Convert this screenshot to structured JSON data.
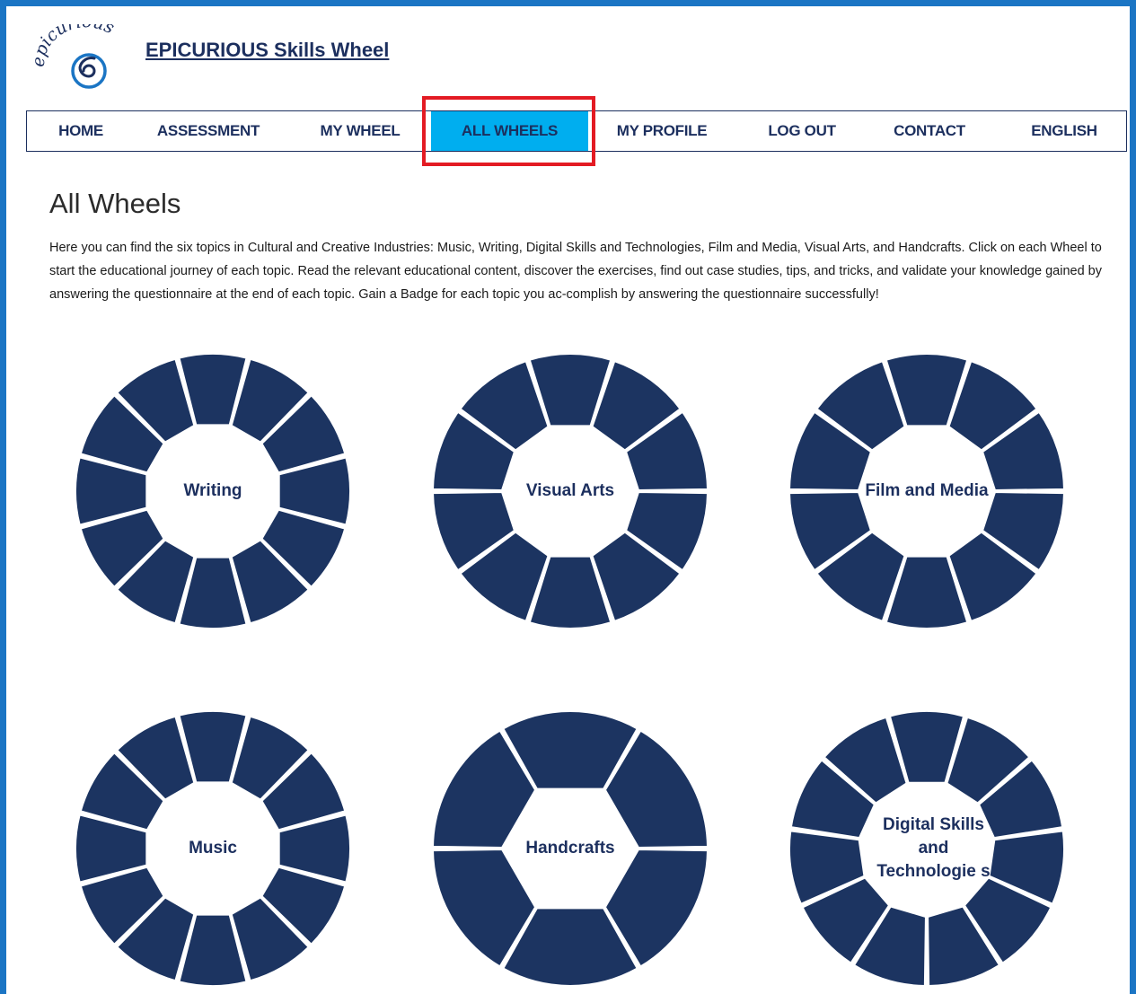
{
  "header": {
    "logo_text": "epicurious",
    "site_title": "EPICURIOUS Skills Wheel"
  },
  "nav": {
    "items": [
      "HOME",
      "ASSESSMENT",
      "MY WHEEL",
      "ALL WHEELS",
      "MY PROFILE",
      "LOG OUT",
      "CONTACT",
      "ENGLISH"
    ],
    "active": "ALL WHEELS"
  },
  "main": {
    "heading": "All Wheels",
    "intro": "Here you can find the six topics in Cultural and Creative Industries: Music, Writing, Digital Skills and Technologies, Film and Media, Visual Arts, and Handcrafts. Click on each Wheel to start the educational journey of each topic. Read the relevant educational content, discover the exercises, find out case studies, tips, and tricks, and validate your knowledge gained by answering the questionnaire at the end of each topic. Gain a Badge for each topic you ac-complish by answering the questionnaire successfully!",
    "wheels": [
      {
        "label": "Writing",
        "segments": 12
      },
      {
        "label": "Visual Arts",
        "segments": 10
      },
      {
        "label": "Film and Media",
        "segments": 10
      },
      {
        "label": "Music",
        "segments": 12
      },
      {
        "label": "Handcrafts",
        "segments": 6
      },
      {
        "label": "Digital Skills and Technologie s",
        "segments": 11
      }
    ]
  },
  "colors": {
    "frame": "#1b75c4",
    "wheel": "#1c3461",
    "nav_active": "#00aeef",
    "highlight": "#e31b23",
    "brand_text": "#1c2f5e"
  }
}
